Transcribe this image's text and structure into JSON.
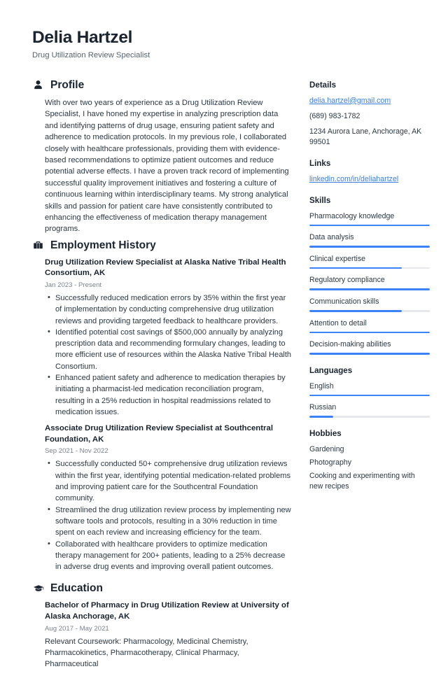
{
  "header": {
    "name": "Delia Hartzel",
    "job_title": "Drug Utilization Review Specialist"
  },
  "accent_color": "#3b82f6",
  "link_color": "#3d7fe0",
  "main": {
    "profile": {
      "icon": "user-icon",
      "title": "Profile",
      "text": "With over two years of experience as a Drug Utilization Review Specialist, I have honed my expertise in analyzing prescription data and identifying patterns of drug usage, ensuring patient safety and adherence to medication protocols. In my previous role, I collaborated closely with healthcare professionals, providing them with evidence-based recommendations to optimize patient outcomes and reduce potential adverse effects. I have a proven track record of implementing successful quality improvement initiatives and fostering a culture of continuous learning within interdisciplinary teams. My strong analytical skills and passion for patient care have consistently contributed to enhancing the effectiveness of medication therapy management programs."
    },
    "employment": {
      "icon": "briefcase-icon",
      "title": "Employment History",
      "entries": [
        {
          "title": "Drug Utilization Review Specialist at Alaska Native Tribal Health Consortium, AK",
          "date": "Jan 2023 - Present",
          "bullets": [
            "Successfully reduced medication errors by 35% within the first year of implementation by conducting comprehensive drug utilization reviews and providing targeted feedback to healthcare providers.",
            "Identified potential cost savings of $500,000 annually by analyzing prescription data and recommending formulary changes, leading to more efficient use of resources within the Alaska Native Tribal Health Consortium.",
            "Enhanced patient safety and adherence to medication therapies by initiating a pharmacist-led medication reconciliation program, resulting in a 25% reduction in hospital readmissions related to medication issues."
          ]
        },
        {
          "title": "Associate Drug Utilization Review Specialist at Southcentral Foundation, AK",
          "date": "Sep 2021 - Nov 2022",
          "bullets": [
            "Successfully conducted 50+ comprehensive drug utilization reviews within the first year, identifying potential medication-related problems and improving patient care for the Southcentral Foundation community.",
            "Streamlined the drug utilization review process by implementing new software tools and protocols, resulting in a 30% reduction in time spent on each review and increasing efficiency for the team.",
            "Collaborated with healthcare providers to optimize medication therapy management for 200+ patients, leading to a 25% decrease in adverse drug events and improving overall patient outcomes."
          ]
        }
      ]
    },
    "education": {
      "icon": "graduation-cap-icon",
      "title": "Education",
      "entries": [
        {
          "title": "Bachelor of Pharmacy in Drug Utilization Review at University of Alaska Anchorage, AK",
          "date": "Aug 2017 - May 2021",
          "coursework": "Relevant Coursework: Pharmacology, Medicinal Chemistry, Pharmacokinetics, Pharmacotherapy, Clinical Pharmacy, Pharmaceutical"
        }
      ]
    }
  },
  "sidebar": {
    "details": {
      "title": "Details",
      "email": "delia.hartzel@gmail.com",
      "phone": "(689) 983-1782",
      "address": "1234 Aurora Lane, Anchorage, AK 99501"
    },
    "links": {
      "title": "Links",
      "items": [
        {
          "label": "linkedin.com/in/deliahartzel"
        }
      ]
    },
    "skills": {
      "title": "Skills",
      "items": [
        {
          "label": "Pharmacology knowledge",
          "level": 100
        },
        {
          "label": "Data analysis",
          "level": 100
        },
        {
          "label": "Clinical expertise",
          "level": 77
        },
        {
          "label": "Regulatory compliance",
          "level": 100
        },
        {
          "label": "Communication skills",
          "level": 77
        },
        {
          "label": "Attention to detail",
          "level": 100
        },
        {
          "label": "Decision-making abilities",
          "level": 100
        }
      ]
    },
    "languages": {
      "title": "Languages",
      "items": [
        {
          "label": "English",
          "level": 100
        },
        {
          "label": "Russian",
          "level": 20
        }
      ]
    },
    "hobbies": {
      "title": "Hobbies",
      "items": [
        {
          "label": "Gardening"
        },
        {
          "label": "Photography"
        },
        {
          "label": "Cooking and experimenting with new recipes"
        }
      ]
    }
  }
}
